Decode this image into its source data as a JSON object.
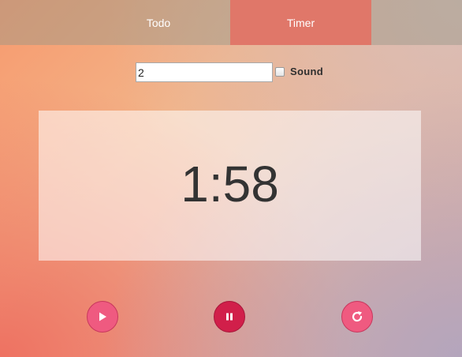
{
  "tabs": {
    "todo_label": "Todo",
    "timer_label": "Timer",
    "active": "Timer"
  },
  "controls": {
    "minutes_value": "2",
    "sound_label": "Sound",
    "sound_checked": false
  },
  "timer": {
    "display": "1:58"
  },
  "buttons": {
    "play_icon": "play-icon",
    "pause_icon": "pause-icon",
    "reset_icon": "refresh-icon"
  },
  "colors": {
    "active_tab": "#e07769",
    "button_pink": "#ef5a80",
    "button_active": "#d11f4a",
    "timer_text": "#333333"
  }
}
